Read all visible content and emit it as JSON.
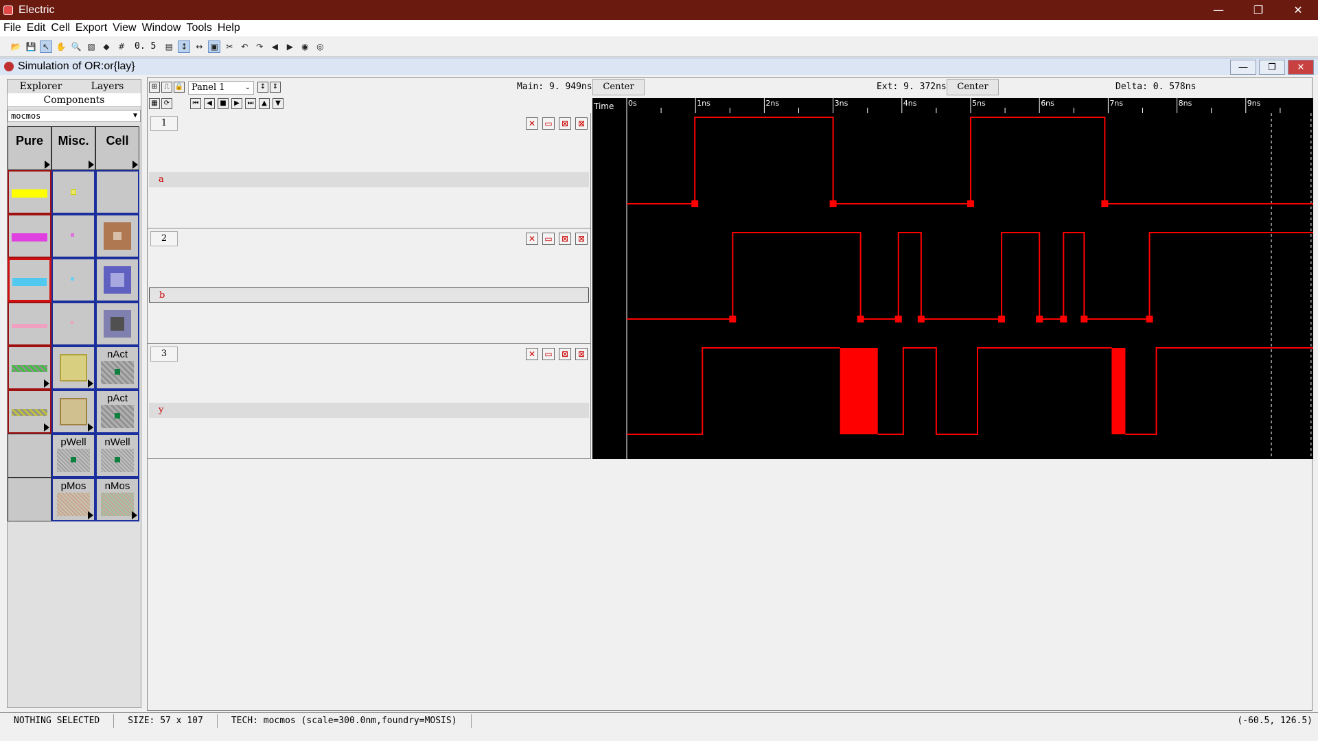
{
  "window": {
    "title": "Electric",
    "minimize": "—",
    "restore": "❐",
    "close": "✕"
  },
  "menu": [
    "File",
    "Edit",
    "Cell",
    "Export",
    "View",
    "Window",
    "Tools",
    "Help"
  ],
  "toolbar": {
    "scale": "0. 5"
  },
  "document": {
    "title": "Simulation of OR:or{lay}"
  },
  "sidebar": {
    "tabs": [
      "Explorer",
      "Layers"
    ],
    "active_tab": "Components",
    "technology": "mocmos",
    "headers": [
      "Pure",
      "Misc.",
      "Cell"
    ],
    "labels": {
      "nact": "nAct",
      "pact": "pAct",
      "pwell": "pWell",
      "nwell": "nWell",
      "pmos": "pMos",
      "nmos": "nMos"
    }
  },
  "waveform": {
    "panel_select": "Panel 1",
    "main_label": "Main: 9. 949ns",
    "ext_label": "Ext: 9. 372ns",
    "delta_label": "Delta: 0. 578ns",
    "center": "Center",
    "time_label": "Time",
    "ticks": [
      "0s",
      "1ns",
      "2ns",
      "3ns",
      "4ns",
      "5ns",
      "6ns",
      "7ns",
      "8ns",
      "9ns"
    ],
    "time_range_ns": [
      0,
      9.98
    ],
    "main_cursor_ns": 9.949,
    "ext_cursor_ns": 9.372,
    "signal_color": "#ff0000",
    "panels": [
      {
        "number": "1",
        "signal": "a",
        "transitions_ns": [
          0.99,
          3.0,
          5.0,
          6.95
        ],
        "initial": 0
      },
      {
        "number": "2",
        "signal": "b",
        "transitions_ns": [
          1.54,
          3.4,
          3.95,
          4.28,
          5.45,
          6.0,
          6.35,
          6.65,
          7.6
        ],
        "initial": 0,
        "selected": true
      },
      {
        "number": "3",
        "signal": "y",
        "segments_ns": [
          [
            0.0,
            1.1,
            0
          ],
          [
            1.1,
            3.1,
            1
          ],
          [
            3.1,
            3.65,
            "x"
          ],
          [
            3.65,
            4.02,
            0
          ],
          [
            4.02,
            4.5,
            1
          ],
          [
            4.5,
            5.1,
            0
          ],
          [
            5.1,
            7.05,
            1
          ],
          [
            7.05,
            7.25,
            "x"
          ],
          [
            7.25,
            7.7,
            0
          ],
          [
            7.7,
            9.98,
            1
          ]
        ]
      }
    ]
  },
  "status": {
    "selection": "NOTHING SELECTED",
    "size": "SIZE: 57 x 107",
    "tech": "TECH: mocmos (scale=300.0nm,foundry=MOSIS)",
    "coords": "(-60.5, 126.5)"
  }
}
